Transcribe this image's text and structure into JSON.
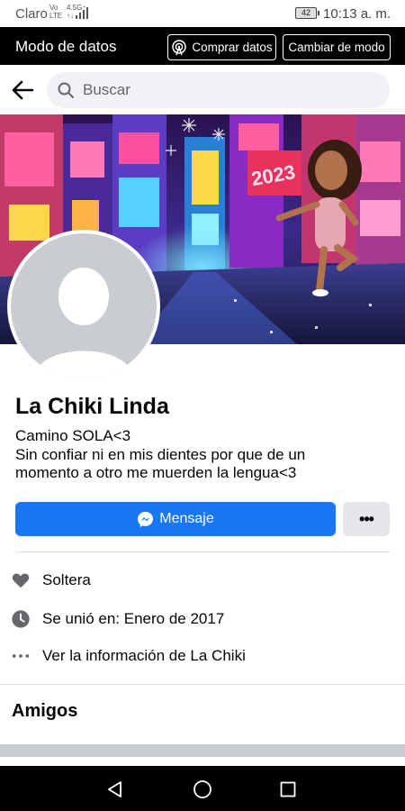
{
  "status_bar": {
    "carrier": "Claro",
    "net_top": "Vo",
    "net_bottom": "LTE",
    "signal_top": "4.5G⁺",
    "signal_bottom": "↑↓",
    "battery": "42",
    "time": "10:13 a. m."
  },
  "data_bar": {
    "title": "Modo de datos",
    "buy_label": "Comprar datos",
    "change_label": "Cambiar de modo"
  },
  "search": {
    "placeholder": "Buscar"
  },
  "profile": {
    "name": "La Chiki Linda",
    "bio_lines": [
      "Camino SOLA<3",
      "Sin confiar ni en mis dientes por que de un",
      "momento a otro me muerden la lengua<3"
    ],
    "message_label": "Mensaje",
    "more_label": "•••"
  },
  "details": {
    "relationship": "Soltera",
    "joined": "Se unió en: Enero de 2017",
    "see_info": "Ver la información de La Chiki"
  },
  "friends": {
    "title": "Amigos"
  },
  "cover": {
    "year_text": "2023"
  },
  "colors": {
    "accent": "#1877f2",
    "search_bg": "#f0f2f5",
    "secondary_btn": "#e4e6eb",
    "icon_gray": "#65676b"
  }
}
